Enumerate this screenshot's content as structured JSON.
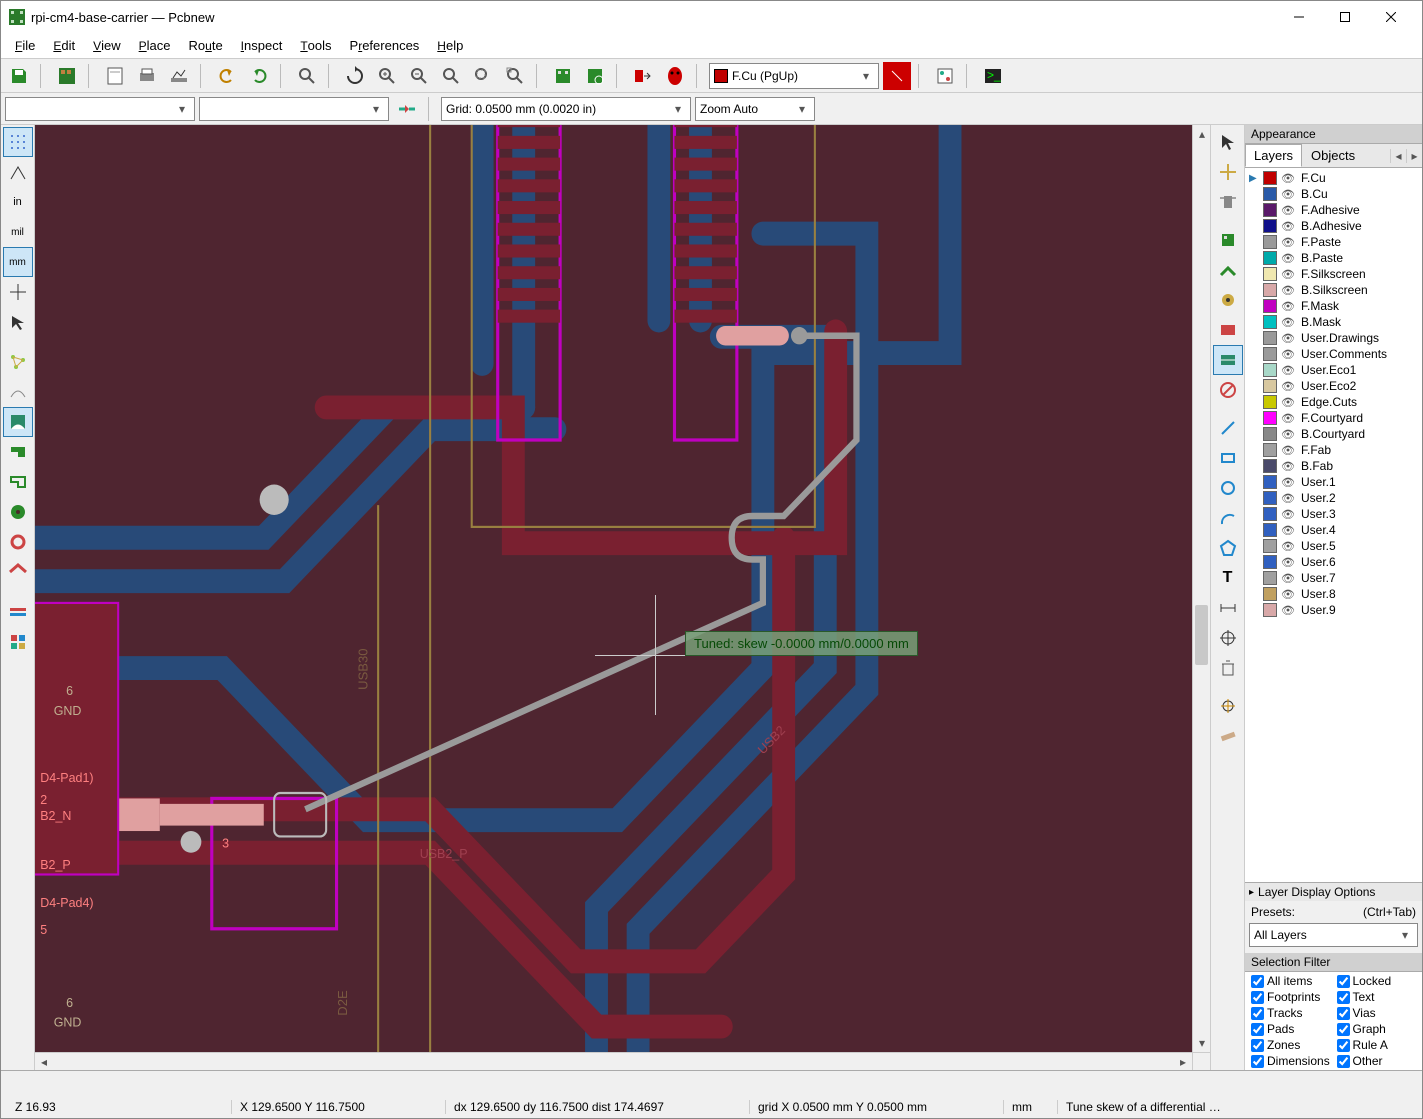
{
  "title": "rpi-cm4-base-carrier — Pcbnew",
  "menu": [
    "File",
    "Edit",
    "View",
    "Place",
    "Route",
    "Inspect",
    "Tools",
    "Preferences",
    "Help"
  ],
  "layer_dropdown": {
    "label": "F.Cu (PgUp)",
    "color": "#c00000"
  },
  "grid_label": "Grid: 0.0500 mm (0.0020 in)",
  "zoom_label": "Zoom Auto",
  "appearance_title": "Appearance",
  "tabs": {
    "layers": "Layers",
    "objects": "Objects"
  },
  "layers": [
    {
      "name": "F.Cu",
      "color": "#c00000",
      "active": true
    },
    {
      "name": "B.Cu",
      "color": "#2a5aa8"
    },
    {
      "name": "F.Adhesive",
      "color": "#5a1a6a"
    },
    {
      "name": "B.Adhesive",
      "color": "#10108a"
    },
    {
      "name": "F.Paste",
      "color": "#9a9a9a"
    },
    {
      "name": "B.Paste",
      "color": "#00aaaa"
    },
    {
      "name": "F.Silkscreen",
      "color": "#f0e8b0"
    },
    {
      "name": "B.Silkscreen",
      "color": "#d8a8a8"
    },
    {
      "name": "F.Mask",
      "color": "#c000c0"
    },
    {
      "name": "B.Mask",
      "color": "#00c0c0"
    },
    {
      "name": "User.Drawings",
      "color": "#9a9a9a"
    },
    {
      "name": "User.Comments",
      "color": "#9a9a9a"
    },
    {
      "name": "User.Eco1",
      "color": "#a8d8c8"
    },
    {
      "name": "User.Eco2",
      "color": "#d8c8a0"
    },
    {
      "name": "Edge.Cuts",
      "color": "#c8c800"
    },
    {
      "name": "F.Courtyard",
      "color": "#ff00ff"
    },
    {
      "name": "B.Courtyard",
      "color": "#888888"
    },
    {
      "name": "F.Fab",
      "color": "#a0a0a0"
    },
    {
      "name": "B.Fab",
      "color": "#4a4a6a"
    },
    {
      "name": "User.1",
      "color": "#3060c0"
    },
    {
      "name": "User.2",
      "color": "#3060c0"
    },
    {
      "name": "User.3",
      "color": "#3060c0"
    },
    {
      "name": "User.4",
      "color": "#3060c0"
    },
    {
      "name": "User.5",
      "color": "#a0a0a0"
    },
    {
      "name": "User.6",
      "color": "#3060c0"
    },
    {
      "name": "User.7",
      "color": "#a0a0a0"
    },
    {
      "name": "User.8",
      "color": "#c0a060"
    },
    {
      "name": "User.9",
      "color": "#d8a8a8"
    }
  ],
  "layer_display_options": "Layer Display Options",
  "presets_label": "Presets:",
  "presets_hint": "(Ctrl+Tab)",
  "presets_value": "All Layers",
  "selfilter_title": "Selection Filter",
  "selfilter": [
    [
      "All items",
      "Locked"
    ],
    [
      "Footprints",
      "Text"
    ],
    [
      "Tracks",
      "Vias"
    ],
    [
      "Pads",
      "Graph"
    ],
    [
      "Zones",
      "Rule A"
    ],
    [
      "Dimensions",
      "Other"
    ]
  ],
  "tuned_text": "Tuned: skew -0.0000 mm/0.0000 mm",
  "canvas_labels": {
    "usb2p": "USB2_P",
    "usb2n": "B2_N",
    "usb2p2": "B2_P",
    "d4pad1": "D4-Pad1)",
    "d4pad4": "D4-Pad4)",
    "gnd1": "GND",
    "gnd2": "GND",
    "n6a": "6",
    "n6b": "6",
    "n2": "2",
    "n3": "3",
    "n5": "5",
    "usb30": "USB30",
    "d2e": "D2E",
    "usb2": "USB2"
  },
  "status": {
    "zoom": "Z 16.93",
    "abs": "X 129.6500  Y 116.7500",
    "rel": "dx 129.6500  dy 116.7500  dist 174.4697",
    "grid": "grid X 0.0500 mm  Y 0.0500 mm",
    "units": "mm",
    "mode": "Tune skew of a differential …"
  }
}
